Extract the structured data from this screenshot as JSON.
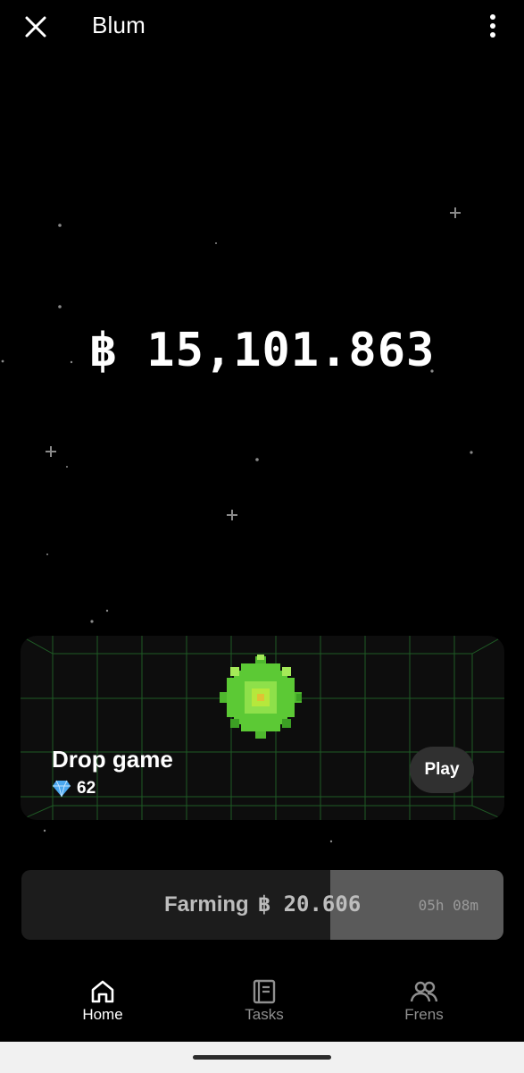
{
  "header": {
    "title": "Blum",
    "close_icon": "close-icon",
    "more_icon": "more-vertical-icon"
  },
  "balance": {
    "text": "฿ 15,101.863"
  },
  "drop_game": {
    "title": "Drop game",
    "count": "62",
    "icon": "diamond-icon",
    "play_label": "Play"
  },
  "farming": {
    "label": "Farming",
    "amount": "฿ 20.606",
    "time_left": "05h 08m",
    "progress_fraction": 0.36
  },
  "nav": [
    {
      "label": "Home",
      "icon": "home-icon",
      "active": true
    },
    {
      "label": "Tasks",
      "icon": "tasks-icon",
      "active": false
    },
    {
      "label": "Frens",
      "icon": "frens-icon",
      "active": false
    }
  ],
  "colors": {
    "background": "#000000",
    "accent_green": "#6fd13a",
    "inactive": "#8f8f8f"
  }
}
